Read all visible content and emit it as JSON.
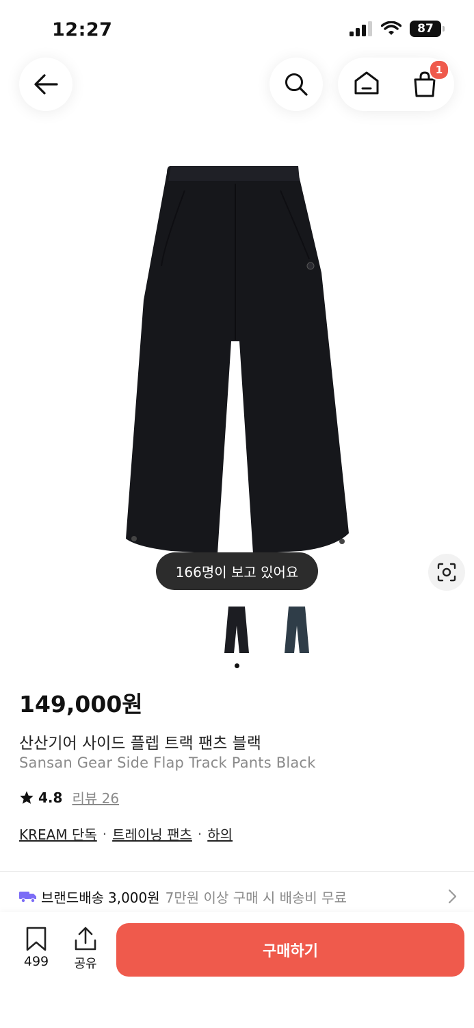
{
  "status_bar": {
    "time": "12:27",
    "battery": "87"
  },
  "header": {
    "cart_badge": "1"
  },
  "gallery": {
    "viewers_text": "166명이 보고 있어요",
    "thumbnails": [
      {
        "color": "#1c1d22"
      },
      {
        "color": "#2f3d48"
      }
    ]
  },
  "product": {
    "price": "149,000원",
    "name_ko": "산산기어 사이드 플렙 트랙 팬츠 블랙",
    "name_en": "Sansan Gear Side Flap Track Pants Black",
    "rating": "4.8",
    "reviews_label": "리뷰 26",
    "tags": [
      "KREAM 단독",
      "트레이닝 팬츠",
      "하의"
    ],
    "tag_separator": "·"
  },
  "shipping": {
    "label": "브랜드배송",
    "fee": "3,000원",
    "note": "7만원 이상 구매 시 배송비 무료"
  },
  "bottom_bar": {
    "bookmark_count": "499",
    "share_label": "공유",
    "buy_label": "구매하기"
  },
  "colors": {
    "accent": "#ef5a4c",
    "shipping_truck": "#7b6cf6"
  }
}
